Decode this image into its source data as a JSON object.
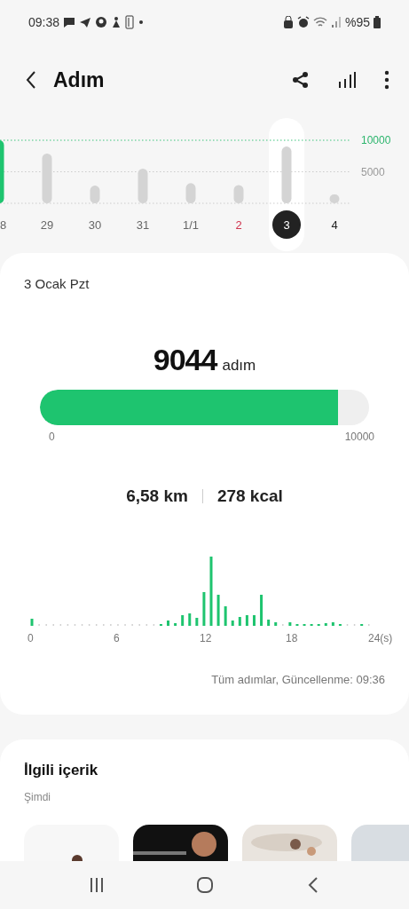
{
  "status_bar": {
    "time": "09:38",
    "battery": "%95"
  },
  "header": {
    "title": "Adım"
  },
  "week_chart": {
    "chart_data": {
      "type": "bar",
      "categories": [
        "8",
        "29",
        "30",
        "31",
        "1/1",
        "2",
        "3",
        "4"
      ],
      "values": [
        10000,
        7900,
        2800,
        5500,
        3200,
        2900,
        9000,
        1400
      ],
      "ylim": [
        0,
        10000
      ],
      "yticks": [
        {
          "value": 5000,
          "label": "5000"
        },
        {
          "value": 10000,
          "label": "10000"
        }
      ]
    },
    "days": [
      {
        "selected": false,
        "sunday": false
      },
      {
        "selected": false,
        "sunday": false
      },
      {
        "selected": false,
        "sunday": false
      },
      {
        "selected": false,
        "sunday": false
      },
      {
        "selected": false,
        "sunday": false
      },
      {
        "selected": false,
        "sunday": true
      },
      {
        "selected": true,
        "sunday": false
      },
      {
        "selected": false,
        "sunday": false
      }
    ]
  },
  "day_summary": {
    "date": "3 Ocak Pzt",
    "steps": "9044",
    "unit": "adım",
    "goal": {
      "level": 0.9044,
      "min": "0",
      "max": "10000"
    },
    "distance": "6,58 km",
    "calories": "278 kcal",
    "hourly": {
      "axis_labels": [
        "0",
        "6",
        "12",
        "18",
        "24(s)"
      ]
    },
    "footer": "Tüm adımlar, Güncellenme: 09:36"
  },
  "related": {
    "title": "İlgili içerik",
    "subtitle": "Şimdi"
  }
}
